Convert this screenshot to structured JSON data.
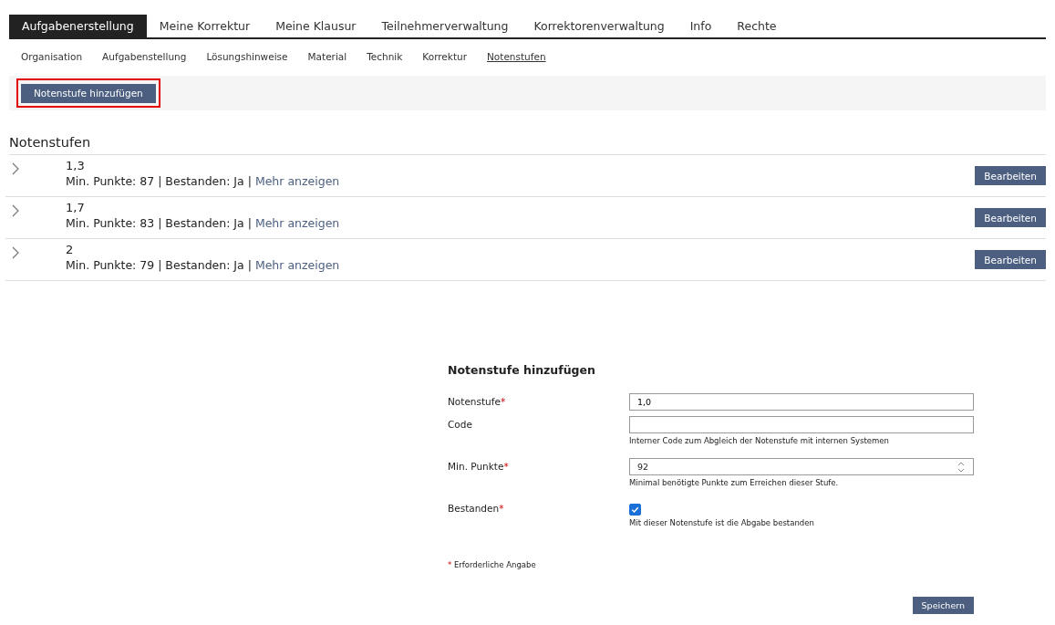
{
  "tabs": [
    {
      "label": "Aufgabenerstellung",
      "selected": true
    },
    {
      "label": "Meine Korrektur",
      "selected": false
    },
    {
      "label": "Meine Klausur",
      "selected": false
    },
    {
      "label": "Teilnehmerverwaltung",
      "selected": false
    },
    {
      "label": "Korrektorenverwaltung",
      "selected": false
    },
    {
      "label": "Info",
      "selected": false
    },
    {
      "label": "Rechte",
      "selected": false
    }
  ],
  "subtabs": [
    {
      "label": "Organisation",
      "selected": false
    },
    {
      "label": "Aufgabenstellung",
      "selected": false
    },
    {
      "label": "Lösungshinweise",
      "selected": false
    },
    {
      "label": "Material",
      "selected": false
    },
    {
      "label": "Technik",
      "selected": false
    },
    {
      "label": "Korrektur",
      "selected": false
    },
    {
      "label": "Notenstufen",
      "selected": true
    }
  ],
  "toolbar": {
    "button": {
      "label": "Notenstufe hinzufügen",
      "highlighted": true
    }
  },
  "list": {
    "title": "Notenstufen",
    "rows": [
      {
        "grade": "1,3",
        "details": "Min. Punkte: 87 | Bestanden: Ja |",
        "link": "Mehr anzeigen",
        "button": "Bearbeiten"
      },
      {
        "grade": "1,7",
        "details": "Min. Punkte: 83 | Bestanden: Ja |",
        "link": "Mehr anzeigen",
        "button": "Bearbeiten"
      },
      {
        "grade": "2",
        "details": "Min. Punkte: 79 | Bestanden: Ja |",
        "link": "Mehr anzeigen",
        "button": "Bearbeiten"
      }
    ]
  },
  "form": {
    "title": "Notenstufe hinzufügen",
    "required_marker": "*",
    "fields": [
      {
        "kind": "text",
        "label": "Notenstufe",
        "required": true,
        "value": "1,0"
      },
      {
        "kind": "text",
        "label": "Code",
        "required": false,
        "help": "Interner Code zum Abgleich der Notenstufe mit internen Systemen"
      },
      {
        "kind": "number",
        "label": "Min. Punkte",
        "required": true,
        "value": "92",
        "help": "Minimal benötigte Punkte zum Erreichen dieser Stufe."
      },
      {
        "kind": "checkbox",
        "label": "Bestanden",
        "required": true,
        "checked": true,
        "help": "Mit dieser Notenstufe ist die Abgabe bestanden"
      }
    ],
    "legend": "Erforderliche Angabe",
    "submit": "Speichern"
  }
}
